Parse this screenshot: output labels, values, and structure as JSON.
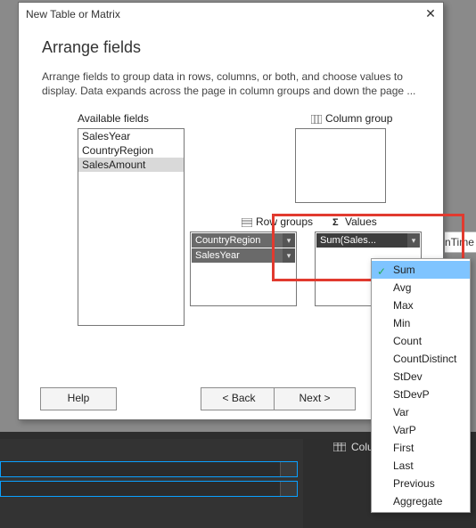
{
  "dialog": {
    "title": "New Table or Matrix",
    "heading": "Arrange fields",
    "description": "Arrange fields to group data in rows, columns, or both, and choose values to display. Data expands across the page in column groups and down the page ...",
    "available_label": "Available fields",
    "available_fields": [
      "SalesYear",
      "CountryRegion",
      "SalesAmount"
    ],
    "selected_available_index": 2,
    "column_groups_label": "Column group",
    "row_groups_label": "Row groups",
    "values_label": "Values",
    "row_groups": [
      "CountryRegion",
      "SalesYear"
    ],
    "values": [
      "Sum(Sales..."
    ],
    "buttons": {
      "help": "Help",
      "back": "<  Back",
      "next": "Next  >"
    }
  },
  "aggregate_menu": {
    "selected": "Sum",
    "items": [
      "Sum",
      "Avg",
      "Max",
      "Min",
      "Count",
      "CountDistinct",
      "StDev",
      "StDevP",
      "Var",
      "VarP",
      "First",
      "Last",
      "Previous",
      "Aggregate"
    ]
  },
  "background": {
    "ntime_fragment": "nTime",
    "column_label": "Colum"
  }
}
